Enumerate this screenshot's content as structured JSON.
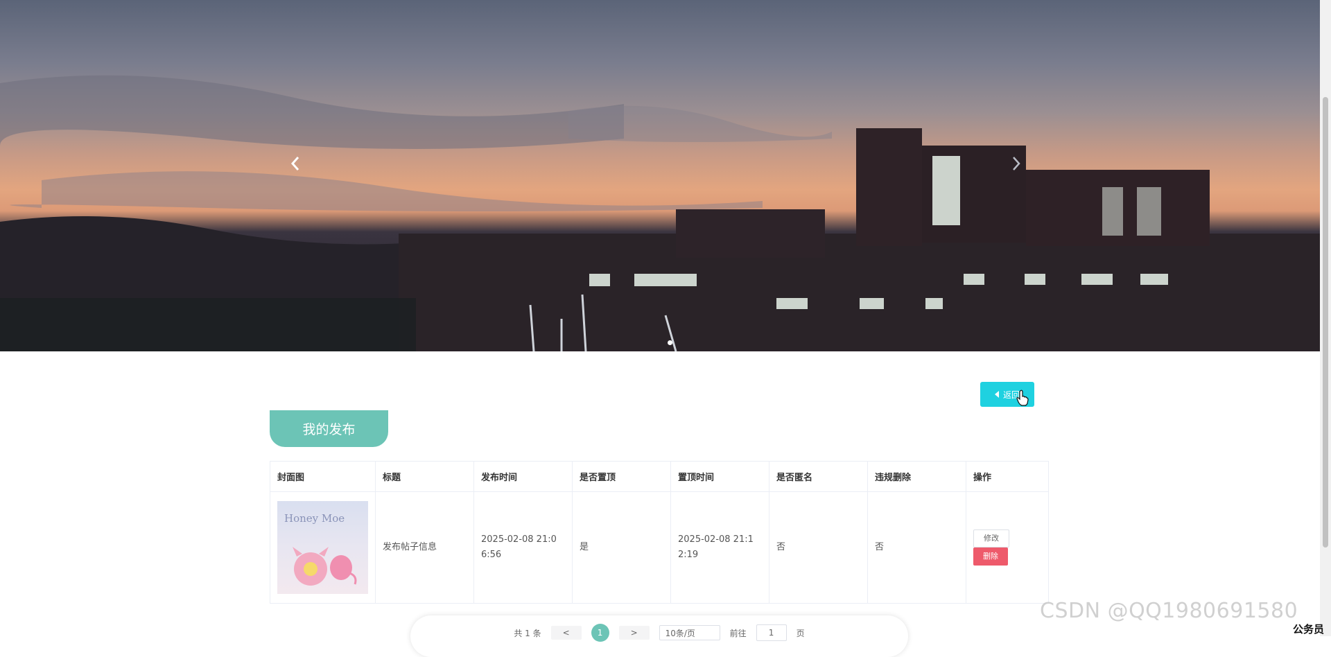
{
  "carousel": {
    "prev_icon": "chevron-left-icon",
    "next_icon": "chevron-right-icon",
    "active_dot": 1
  },
  "back_button": {
    "label": "返回",
    "icon": "caret-left-icon"
  },
  "section": {
    "title": "我的发布"
  },
  "table": {
    "headers": [
      "封面图",
      "标题",
      "发布时间",
      "是否置顶",
      "置顶时间",
      "是否匿名",
      "违规删除",
      "操作"
    ],
    "rows": [
      {
        "cover_text": "Honey Moe",
        "title": "发布帖子信息",
        "publish_time": "2025-02-08 21:06:56",
        "is_top": "是",
        "top_time": "2025-02-08 21:12:19",
        "is_anonymous": "否",
        "violation_deleted": "否",
        "edit_label": "修改",
        "delete_label": "删除"
      }
    ]
  },
  "pagination": {
    "total": "共 1 条",
    "prev": "<",
    "current_page": "1",
    "next": ">",
    "page_size": "10条/页",
    "goto_prefix": "前往",
    "goto_value": "1",
    "goto_suffix": "页"
  },
  "watermark": "CSDN @QQ1980691580",
  "corner_text": "公务员",
  "colors": {
    "accent": "#6cc4b6",
    "back_button": "#1fd1e0",
    "delete_button": "#ee5a6b"
  }
}
